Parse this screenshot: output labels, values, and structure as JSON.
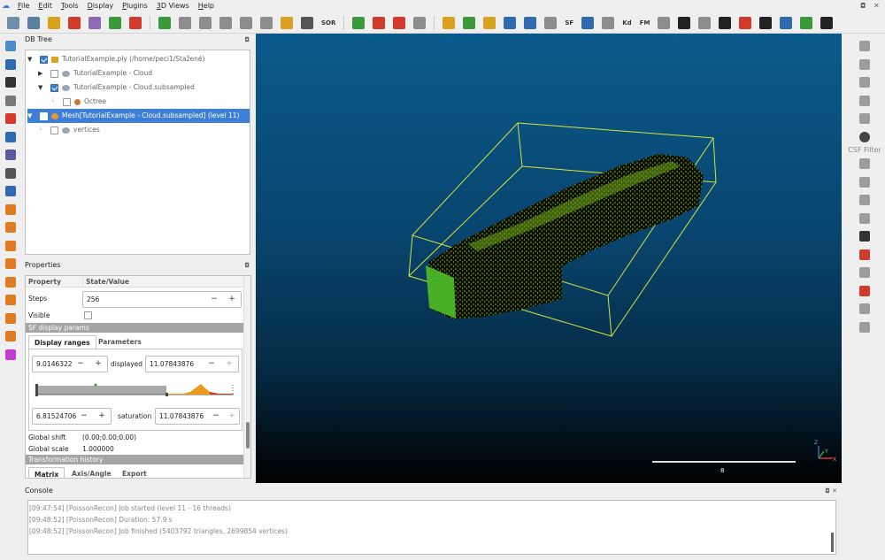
{
  "menubar": {
    "items": [
      {
        "label": "File",
        "u": "F",
        "rest": "ile"
      },
      {
        "label": "Edit",
        "u": "E",
        "rest": "dit"
      },
      {
        "label": "Tools",
        "u": "T",
        "rest": "ools"
      },
      {
        "label": "Display",
        "u": "D",
        "rest": "isplay"
      },
      {
        "label": "Plugins",
        "u": "P",
        "rest": "lugins"
      },
      {
        "label": "3D Views",
        "u": "3",
        "rest": "D Views"
      },
      {
        "label": "Help",
        "u": "H",
        "rest": "elp"
      }
    ]
  },
  "toolbar": {
    "text_buttons": {
      "sor": "SOR",
      "sf": "SF",
      "kd": "Kd",
      "fm": "FM"
    },
    "colors": {
      "default": "#6f8fa8",
      "red": "#d23b2b",
      "green": "#3a9a3a",
      "yellow": "#d8a21f",
      "gray": "#8d8d8d",
      "blue": "#2e6bb3",
      "orange": "#e07b22"
    }
  },
  "right_tools": {
    "csf_label": "CSF Filter"
  },
  "db_tree": {
    "title": "DB Tree",
    "dock_icon": "◘",
    "rows": [
      {
        "label": "TutorialExample.ply (/home/peci1/Stažené)",
        "checked": true,
        "expanded": true
      },
      {
        "label": "TutorialExample - Cloud",
        "checked": false,
        "expanded": false
      },
      {
        "label": "TutorialExample - Cloud.subsampled",
        "checked": true,
        "expanded": true
      },
      {
        "label": "Octree",
        "checked": false
      },
      {
        "label": "Mesh[TutorialExample - Cloud.subsampled] (level 11)",
        "checked": true,
        "expanded": true,
        "selected": true
      },
      {
        "label": "vertices",
        "checked": false
      }
    ]
  },
  "properties": {
    "title": "Properties",
    "dock_icon": "◘",
    "header": {
      "property": "Property",
      "value": "State/Value"
    },
    "steps": {
      "label": "Steps",
      "value": "256"
    },
    "visible": {
      "label": "Visible",
      "checked": false
    },
    "sf_section": "SF display params",
    "tabs": {
      "display_ranges": "Display ranges",
      "parameters": "Parameters"
    },
    "displayed": {
      "min": "9.0146322",
      "label": "displayed",
      "max": "11.07843876"
    },
    "saturation": {
      "min": "6.81524706",
      "label": "saturation",
      "max": "11.07843876"
    },
    "global_shift": {
      "label": "Global shift",
      "value": "(0.00;0.00;0.00)"
    },
    "global_scale": {
      "label": "Global scale",
      "value": "1.000000"
    },
    "transformation_section": "Transformation history",
    "bottom_tabs": {
      "matrix": "Matrix",
      "axis_angle": "Axis/Angle",
      "export": "Export"
    }
  },
  "viewport": {
    "scale_label": "8",
    "bbox_color": "#d8e43a",
    "axis": {
      "x": "X",
      "y": "Y",
      "z": "Z"
    }
  },
  "console": {
    "title": "Console",
    "dock_icons": "◘ ✕",
    "lines": [
      "[09:47:54] [PoissonRecon] Job started (level 11 - 16 threads)",
      "[09:48:52] [PoissonRecon] Duration: 57.9 s",
      "[09:48:52] [PoissonRecon] Job finished (5403792 triangles, 2699854 vertices)"
    ]
  },
  "window_controls": {
    "restore": "◘",
    "close": "✕"
  }
}
